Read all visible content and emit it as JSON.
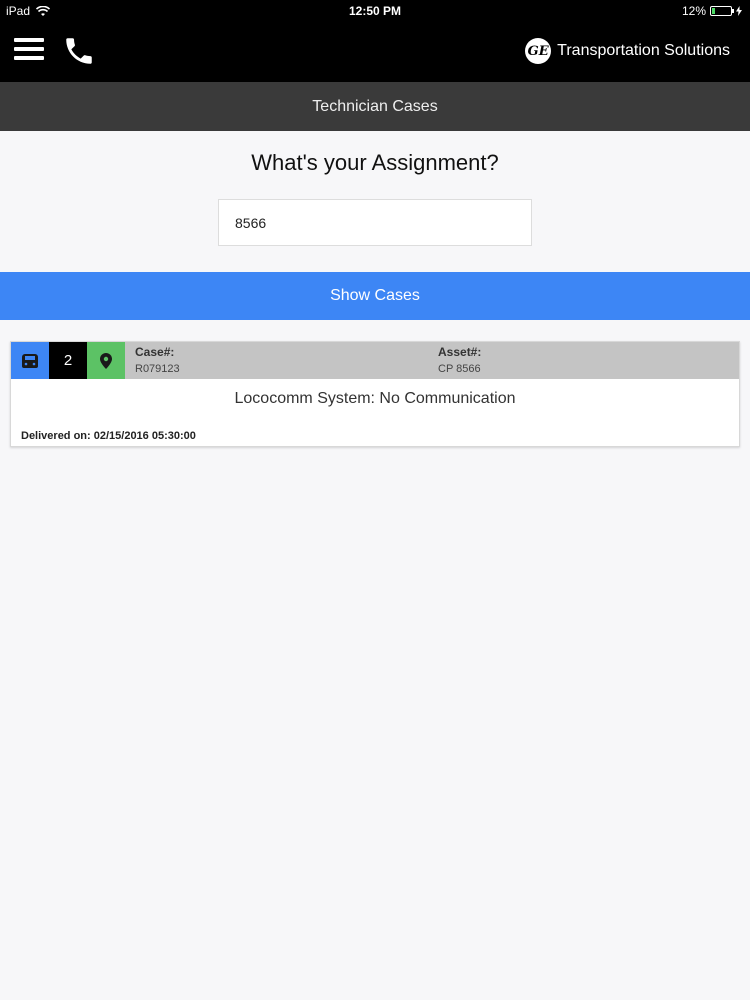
{
  "status": {
    "device": "iPad",
    "time": "12:50 PM",
    "battery": "12%"
  },
  "header": {
    "brand_logo": "GE",
    "brand_name": "Transportation Solutions",
    "icons": [
      "menu-icon",
      "phone-icon"
    ]
  },
  "subheader": {
    "title": "Technician Cases"
  },
  "main": {
    "prompt": "What's your Assignment?",
    "assignment_value": "8566",
    "show_button": "Show Cases"
  },
  "cases": [
    {
      "count": "2",
      "case_label": "Case#:",
      "case_number": "R079123",
      "asset_label": "Asset#:",
      "asset_number": "CP 8566",
      "title": "Lococomm System: No Communication",
      "delivered": "Delivered on: 02/15/2016 05:30:00"
    }
  ],
  "colors": {
    "accent_blue": "#3d86f5",
    "status_green": "#5cc265",
    "header_black": "#000000",
    "subheader_gray": "#3a3a3a",
    "case_header_gray": "#c4c4c4"
  }
}
